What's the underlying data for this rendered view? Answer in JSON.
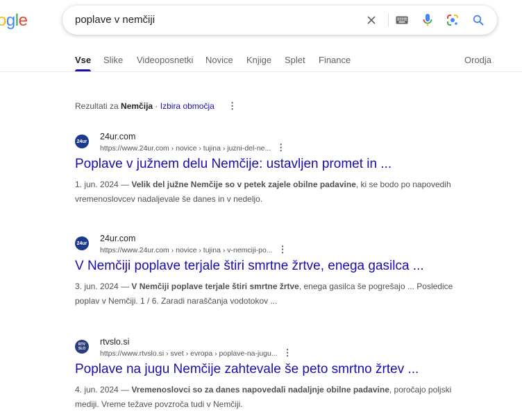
{
  "logo": {
    "visible_text": "ogle",
    "colors": [
      "#fbbc05",
      "#4285f4",
      "#34a853",
      "#ea4335"
    ]
  },
  "search": {
    "query": "poplave v nemčiji"
  },
  "icons": {
    "clear": "close-icon",
    "keyboard": "keyboard-icon",
    "voice": "microphone-icon",
    "lens": "google-lens-icon",
    "search": "search-icon"
  },
  "tabs": [
    {
      "label": "Vse",
      "active": true
    },
    {
      "label": "Slike"
    },
    {
      "label": "Videoposnetki"
    },
    {
      "label": "Novice"
    },
    {
      "label": "Knjige"
    },
    {
      "label": "Splet"
    },
    {
      "label": "Finance"
    }
  ],
  "tools_label": "Orodja",
  "region": {
    "prefix": "Rezultati za",
    "place": "Nemčija",
    "separator": "·",
    "link": "Izbira območja"
  },
  "results": [
    {
      "favicon_text": "24ur",
      "favicon_color": "#1b3a8c",
      "site": "24ur.com",
      "url": "https://www.24ur.com › novice › tujina › juzni-del-ne...",
      "title": "Poplave v južnem delu Nemčije: ustavljen promet in ...",
      "date": "1. jun. 2024",
      "dash": "—",
      "snippet_bold": "Velik del južne Nemčije so v petek zajele obilne padavine",
      "snippet_rest": ", ki se bodo po napovedih vremenoslovcev nadaljevale še danes in v nedeljo."
    },
    {
      "favicon_text": "24ur",
      "favicon_color": "#1b3a8c",
      "site": "24ur.com",
      "url": "https://www.24ur.com › novice › tujina › v-nemciji-po...",
      "title": "V Nemčiji poplave terjale štiri smrtne žrtve, enega gasilca ...",
      "date": "3. jun. 2024",
      "dash": "—",
      "snippet_bold": "V Nemčiji poplave terjale štiri smrtne žrtve",
      "snippet_rest": ", enega gasilca še pogrešajo ... Posledice poplav v Nemčiji. 1 / 6. Zaradi naraščanja vodotokov ..."
    },
    {
      "favicon_text": "RTV SLO",
      "favicon_color": "#2a3f7a",
      "site": "rtvslo.si",
      "url": "https://www.rtvslo.si › svet › evropa › poplave-na-jugu...",
      "title": "Poplave na jugu Nemčije zahtevale še peto smrtno žrtev ...",
      "date": "4. jun. 2024",
      "dash": "—",
      "snippet_bold": "Vremenoslovci so za danes napovedali nadaljnje obilne padavine",
      "snippet_rest": ", poročajo poljski mediji. Vreme težave povzroča tudi v Nemčiji."
    }
  ]
}
